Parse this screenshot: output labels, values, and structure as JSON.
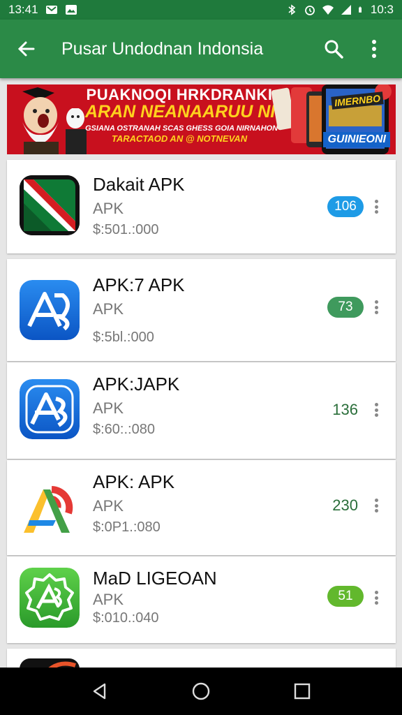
{
  "status_bar": {
    "time": "13:41",
    "battery": "10:3"
  },
  "toolbar": {
    "title": "Pusar Undodnan Indonsia"
  },
  "banner": {
    "line1": "PUAKNOQI HRKDRANKI",
    "line2": "ARAN NEANAARUU NIOS!",
    "line3": "GSIANA OSTRANAH SCAS GHESS GOIA NIRNAHON",
    "line4": "TARACTAOD AN @ NOTNEVAN",
    "phone_tag": "IMERNBO",
    "phone_label": "GUINIEONI"
  },
  "apps": [
    {
      "name": "Dakait APK",
      "type": "APK",
      "price": "$:501.:000",
      "count": "106",
      "badge_color": "#1e9be6",
      "icon": "flag-icon"
    },
    {
      "name": "APK:7 APK",
      "type": "APK",
      "price": "$:5bl.:000",
      "count": "73",
      "badge_color": "#3f9a5d",
      "icon": "app-store-a-icon"
    },
    {
      "name": "APK:JAPK",
      "type": "APK",
      "price": "$:60:.:080",
      "count": "136",
      "badge_color": "",
      "icon": "app-store-a-icon"
    },
    {
      "name": "APK: APK",
      "type": "APK",
      "price": "$:0P1.:080",
      "count": "230",
      "badge_color": "",
      "icon": "colorful-a-icon"
    },
    {
      "name": "MaD LIGEOAN",
      "type": "APK",
      "price": "$:010.:040",
      "count": "51",
      "badge_color": "#62b82d",
      "icon": "green-badge-a-icon"
    }
  ]
}
